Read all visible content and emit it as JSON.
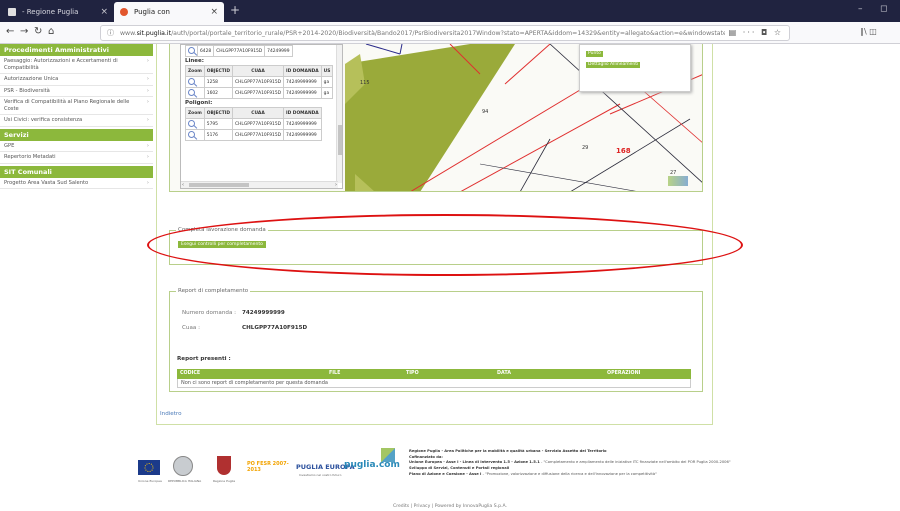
{
  "browser": {
    "tabs": [
      {
        "title": "- Regione Puglia",
        "close": "×"
      },
      {
        "title": "Puglia con",
        "close": "×"
      }
    ],
    "new_tab": "+",
    "window_controls": [
      "–",
      "◻"
    ],
    "url_info": "ⓘ",
    "url_prefix": "www.",
    "url_domain": "sit.puglia.it",
    "url_rest": "/auth/portal/portale_territorio_rurale/PSR+2014-2020/Biodiversità/Bando2017/PsrBiodiversita2017Window?stato=APERTA&iddom=14329&entity=allegato&action=e&windowstate=normal",
    "url_icons": "▤ ··· ◘ ☆",
    "right_icons": "∥\\ ◫"
  },
  "sidebar": {
    "sections": [
      {
        "title": "Procedimenti Amministrativi",
        "items": [
          "Paesaggio: Autorizzazioni e Accertamenti di Compatibilità",
          "Autorizzazione Unica",
          "PSR - Biodiversità",
          "Verifica di Compatibilità al Piano Regionale delle Coste",
          "Usi Civici: verifica consistenza"
        ]
      },
      {
        "title": "Servizi",
        "items": [
          "GPE",
          "Repertorio Metadati"
        ]
      },
      {
        "title": "SIT Comunali",
        "items": [
          "Progetto Area Vasta Sud Salento"
        ]
      }
    ],
    "arrow": "›"
  },
  "map_table": {
    "top_rows": [
      [
        "6428",
        "CHLGPP77A10F915D",
        "74249999"
      ]
    ],
    "lines_title": "Linee:",
    "headers": [
      "Zoom",
      "OBJECTID",
      "CUAA",
      "ID DOMANDA",
      "US"
    ],
    "lines_rows": [
      [
        "1258",
        "CHLGPP77A10F915D",
        "74249999999",
        "ga"
      ],
      [
        "1602",
        "CHLGPP77A10F915D",
        "74249999999",
        "ga"
      ]
    ],
    "polygons_title": "Poligoni:",
    "poly_headers": [
      "Zoom",
      "OBJECTID",
      "CUAA",
      "ID DOMANDA"
    ],
    "poly_rows": [
      [
        "5795",
        "CHLGPP77A10F915D",
        "74249999999"
      ],
      [
        "5176",
        "CHLGPP77A10F915D",
        "74249999999"
      ]
    ],
    "scroll_left": "‹",
    "scroll_right": "›"
  },
  "map_labels": {
    "n115": "115",
    "n94": "94",
    "n29": "29",
    "n168": "168",
    "n27": "27"
  },
  "legend": {
    "btn1": "Punto",
    "btn2": "Dettaglio Allineamenti"
  },
  "completa": {
    "legend": "Completa lavorazione domanda",
    "button": "Esegui controlli per completamento"
  },
  "report": {
    "legend": "Report di completamento",
    "numero_label": "Numero domanda :",
    "numero_value": "74249999999",
    "cuaa_label": "Cuaa :",
    "cuaa_value": "CHLGPP77A10F915D",
    "presenti_title": "Report presenti :",
    "columns": [
      "CODICE",
      "FILE",
      "TIPO",
      "DATA",
      "OPERAZIONI"
    ],
    "empty_text": "Non ci sono report di completamento per questa domanda"
  },
  "indietro": "Indietro",
  "footer": {
    "logo_captions": [
      "Unione Europea",
      "REPUBBLICA ITALIANA",
      "Regione Puglia"
    ],
    "poafesr": "PO FESR 2007-2013",
    "puglia_europa": "PUGLIA EUROPA",
    "puglia_europa_sub": "Investiamo nel vostro futuro",
    "puglia_com": "puglia.com",
    "lines": [
      {
        "b": "Regione Puglia - Area Politiche per la mobilità e qualità urbana - Servizio Assetto del Territorio",
        "t": ""
      },
      {
        "b": "Cofinanziato da:",
        "t": ""
      },
      {
        "b": "Unione Europea - Asse I - Linea di Intervento 1.5 - Azione 1.5.1",
        "t": " - \"Completamento e ampliamento delle iniziative ITC finanziate nell'ambito del POR Puglia 2000-2006\""
      },
      {
        "b": "Sviluppo di Servizi, Contenuti e Portali regionali",
        "t": ""
      },
      {
        "b": "Piano di Azione e Coesione - Asse I",
        "t": " - \"Promozione, valorizzazione e diffusione della ricerca e dell'innovazione per la competitività\""
      }
    ]
  },
  "credits": "Credits | Privacy | Powered by InnovaPuglia S.p.A.",
  "colors": {
    "accent": "#8cb83c",
    "annotation": "#d11111"
  }
}
